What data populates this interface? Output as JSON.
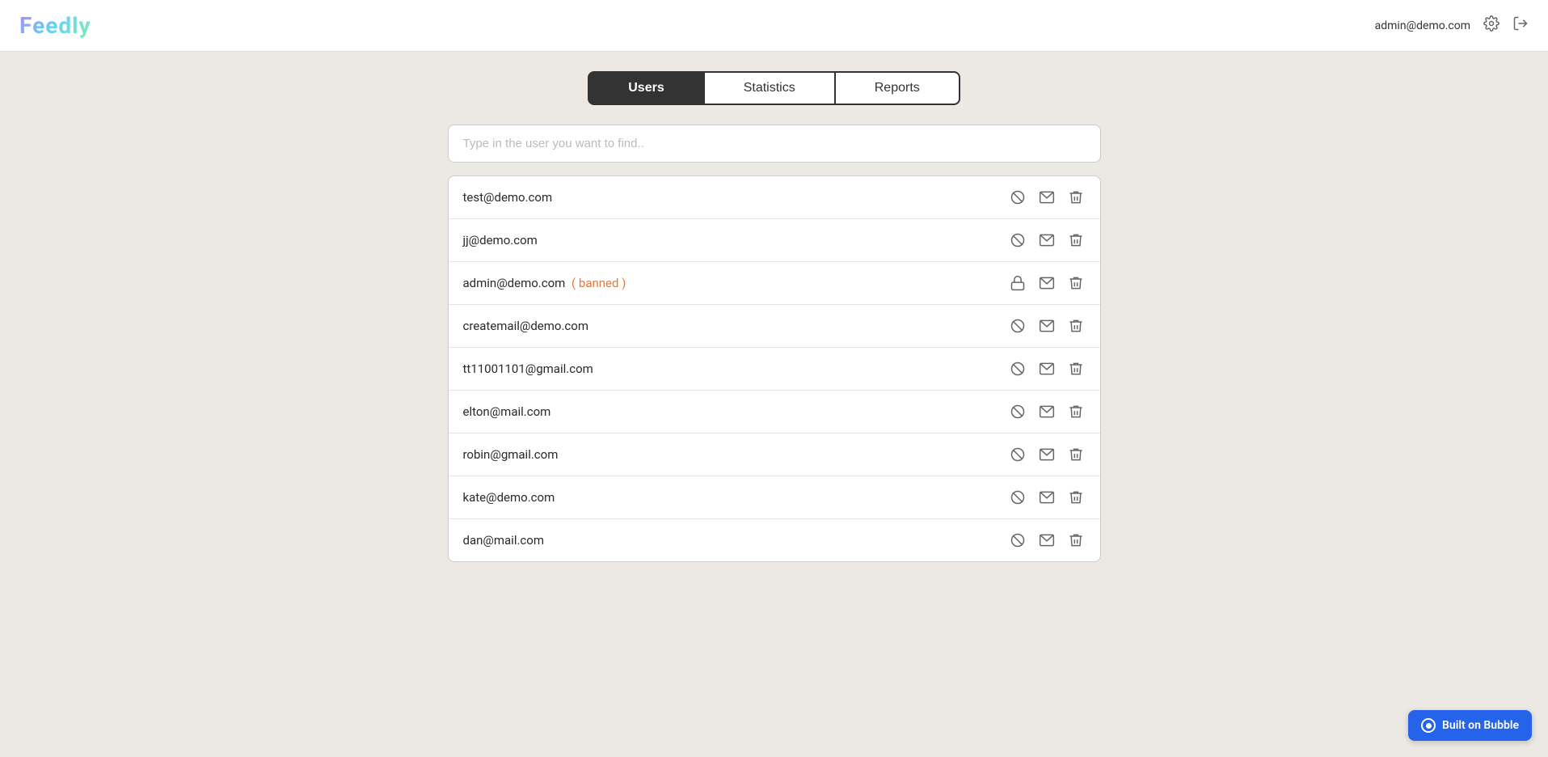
{
  "header": {
    "logo": "Feedly",
    "admin_email": "admin@demo.com",
    "settings_icon": "gear-icon",
    "logout_icon": "logout-icon"
  },
  "nav": {
    "tabs": [
      {
        "id": "users",
        "label": "Users",
        "active": true
      },
      {
        "id": "statistics",
        "label": "Statistics",
        "active": false
      },
      {
        "id": "reports",
        "label": "Reports",
        "active": false
      }
    ]
  },
  "search": {
    "placeholder": "Type in the user you want to find.."
  },
  "users": [
    {
      "email": "test@demo.com",
      "banned": false,
      "id": "user-1"
    },
    {
      "email": "jj@demo.com",
      "banned": false,
      "id": "user-2"
    },
    {
      "email": "admin@demo.com",
      "banned": true,
      "id": "user-3"
    },
    {
      "email": "createmail@demo.com",
      "banned": false,
      "id": "user-4"
    },
    {
      "email": "tt11001101@gmail.com",
      "banned": false,
      "id": "user-5"
    },
    {
      "email": "elton@mail.com",
      "banned": false,
      "id": "user-6"
    },
    {
      "email": "robin@gmail.com",
      "banned": false,
      "id": "user-7"
    },
    {
      "email": "kate@demo.com",
      "banned": false,
      "id": "user-8"
    },
    {
      "email": "dan@mail.com",
      "banned": false,
      "id": "user-9"
    }
  ],
  "bubble_badge": {
    "label": "Built on Bubble"
  }
}
